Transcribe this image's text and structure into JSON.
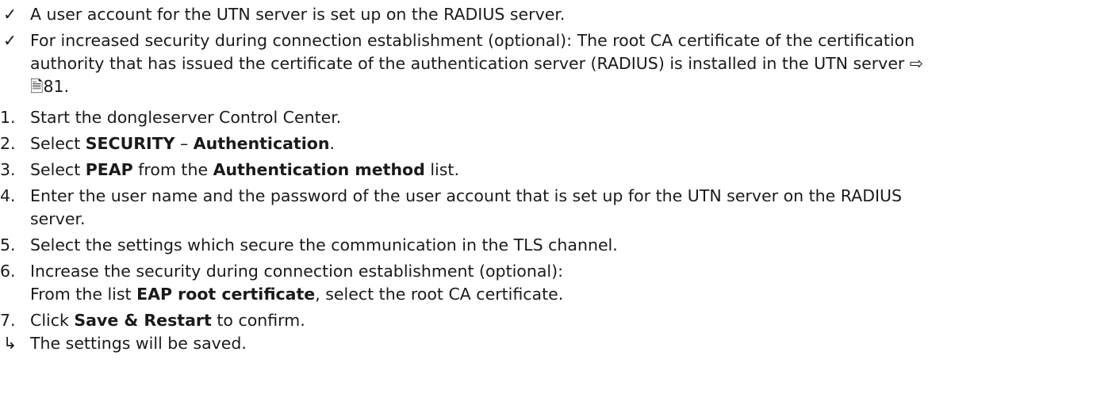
{
  "prerequisites": [
    {
      "marker": "✓",
      "text": "A user account for the UTN server is set up on the RADIUS server."
    },
    {
      "marker": "✓",
      "text_line1": "For increased security during connection establishment (optional): The root CA certificate of the certification",
      "text_line2": "authority that has issued the certificate of the authentication server (RADIUS) is installed in the UTN server ⇨",
      "doc_icon": "🗎",
      "page_ref": "81."
    }
  ],
  "steps": [
    {
      "number": "1.",
      "text": "Start the dongleserver Control Center."
    },
    {
      "number": "2.",
      "prefix": "Select ",
      "bold1": "SECURITY",
      "middle": " – ",
      "bold2": "Authentication",
      "suffix": "."
    },
    {
      "number": "3.",
      "prefix": "Select ",
      "bold1": "PEAP",
      "middle": " from the ",
      "bold2": "Authentication method",
      "suffix": " list."
    },
    {
      "number": "4.",
      "text_line1": "Enter the user name and the password of the user account that is set up for the UTN server on the RADIUS",
      "text_line2": "server."
    },
    {
      "number": "5.",
      "text": "Select the settings which secure the communication in the TLS channel."
    },
    {
      "number": "6.",
      "text_line1": "Increase the security during connection establishment (optional):",
      "line2_prefix": "From the list ",
      "line2_bold": "EAP root certificate",
      "line2_suffix": ", select the root CA certificate."
    },
    {
      "number": "7.",
      "prefix": "Click ",
      "bold": "Save & Restart",
      "suffix": " to confirm."
    }
  ],
  "result": {
    "marker": "↳",
    "text": "The settings will be saved."
  }
}
